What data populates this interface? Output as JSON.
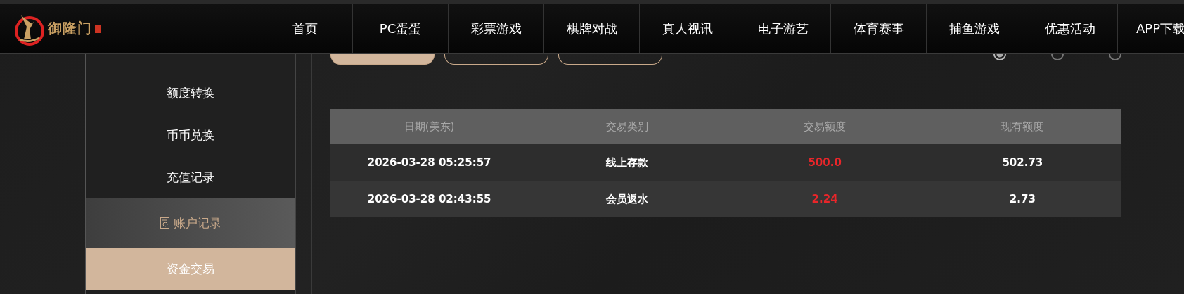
{
  "header": {
    "logo_text": "御隆门",
    "nav": [
      {
        "label": "首页"
      },
      {
        "label": "PC蛋蛋"
      },
      {
        "label": "彩票游戏"
      },
      {
        "label": "棋牌对战"
      },
      {
        "label": "真人视讯"
      },
      {
        "label": "电子游艺"
      },
      {
        "label": "体育赛事"
      },
      {
        "label": "捕鱼游戏"
      },
      {
        "label": "优惠活动"
      },
      {
        "label": "APP下载"
      }
    ]
  },
  "sidebar": {
    "items": [
      {
        "kind": "link",
        "label": "额度转换",
        "selected": false
      },
      {
        "kind": "link",
        "label": "币币兑换",
        "selected": false
      },
      {
        "kind": "link",
        "label": "充值记录",
        "selected": false
      },
      {
        "kind": "group",
        "label": "账户记录",
        "selected": false
      },
      {
        "kind": "link",
        "label": "资金交易",
        "selected": true
      }
    ]
  },
  "filter_buttons": [
    {
      "selected": true
    },
    {
      "selected": false
    },
    {
      "selected": false
    }
  ],
  "period_radios": [
    {
      "selected": true
    },
    {
      "selected": false
    },
    {
      "selected": false
    }
  ],
  "table": {
    "columns": [
      "日期(美东)",
      "交易类别",
      "交易额度",
      "现有额度"
    ],
    "rows": [
      [
        "2026-03-28 05:25:57",
        "线上存款",
        "500.0",
        "502.73"
      ],
      [
        "2026-03-28 02:43:55",
        "会员返水",
        "2.24",
        "2.73"
      ]
    ]
  }
}
